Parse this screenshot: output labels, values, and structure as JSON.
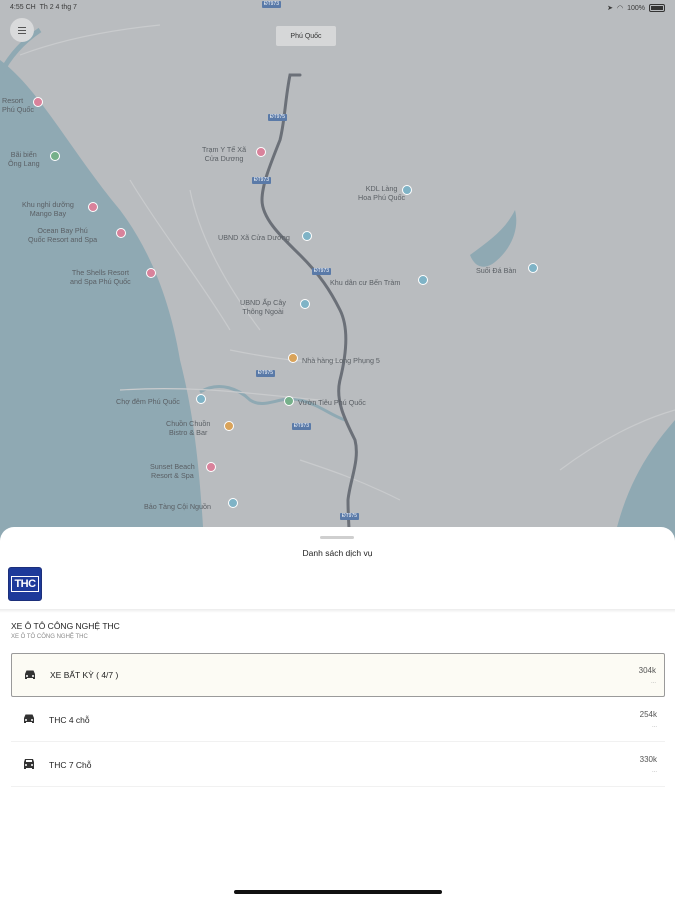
{
  "status_bar": {
    "time": "4:55 CH",
    "date": "Th 2 4 thg 7",
    "battery": "100%"
  },
  "map": {
    "callout": "Phú Quốc",
    "places": [
      {
        "name": "Resort\nPhú Quốc",
        "pin": "pink"
      },
      {
        "name": "Bãi biển\nÔng Lang",
        "pin": "green"
      },
      {
        "name": "Khu nghỉ dưỡng\nMango Bay",
        "pin": "pink"
      },
      {
        "name": "Ocean Bay Phú\nQuốc Resort and Spa",
        "pin": "pink"
      },
      {
        "name": "The Shells Resort\nand Spa Phú Quốc",
        "pin": "pink"
      },
      {
        "name": "Trạm Y Tế Xã\nCửa Dương",
        "pin": "pink"
      },
      {
        "name": "KDL Làng\nHoa Phú Quốc",
        "pin": "teal"
      },
      {
        "name": "UBND Xã Cửa Dương",
        "pin": "teal"
      },
      {
        "name": "Khu dân cư Bến Tràm",
        "pin": "teal"
      },
      {
        "name": "Suối Đá Bàn",
        "pin": "teal"
      },
      {
        "name": "UBND Ấp Cây\nThông Ngoài",
        "pin": "teal"
      },
      {
        "name": "Nhà hàng Long Phụng 5",
        "pin": "orange"
      },
      {
        "name": "Chợ đêm Phú Quốc",
        "pin": "teal"
      },
      {
        "name": "Vườn Tiêu Phú Quốc",
        "pin": "green"
      },
      {
        "name": "Chuồn Chuồn\nBistro & Bar",
        "pin": "orange"
      },
      {
        "name": "Sunset Beach\nResort & Spa",
        "pin": "pink"
      },
      {
        "name": "Bảo Tàng Cội Nguồn",
        "pin": "teal"
      }
    ],
    "roads": [
      "ĐT973",
      "ĐT975",
      "ĐT973",
      "ĐT973",
      "ĐT975",
      "ĐT973",
      "ĐT975",
      "ĐT973"
    ]
  },
  "sheet": {
    "title": "Danh sách dịch vụ",
    "provider_logo": "THC",
    "provider_name": "XE Ô TÔ CÔNG NGHỆ THC",
    "provider_subtitle": "XE Ô TÔ CÔNG NGHỆ THC",
    "services": [
      {
        "name": "XE BẤT KỲ ( 4/7 )",
        "price": "304k",
        "sub": "...",
        "selected": true
      },
      {
        "name": "THC 4 chỗ",
        "price": "254k",
        "sub": "...",
        "selected": false
      },
      {
        "name": "THC 7 Chỗ",
        "price": "330k",
        "sub": "...",
        "selected": false
      }
    ]
  },
  "colors": {
    "map_land": "#b9bcbf",
    "map_water": "#8fa9b3",
    "road": "#6b7078",
    "logo_blue": "#1d3a9a"
  },
  "icons": {
    "menu": "menu-icon",
    "wifi": "wifi-icon",
    "location_arrow": "location-arrow-icon",
    "battery": "battery-icon",
    "car": "car-icon"
  }
}
